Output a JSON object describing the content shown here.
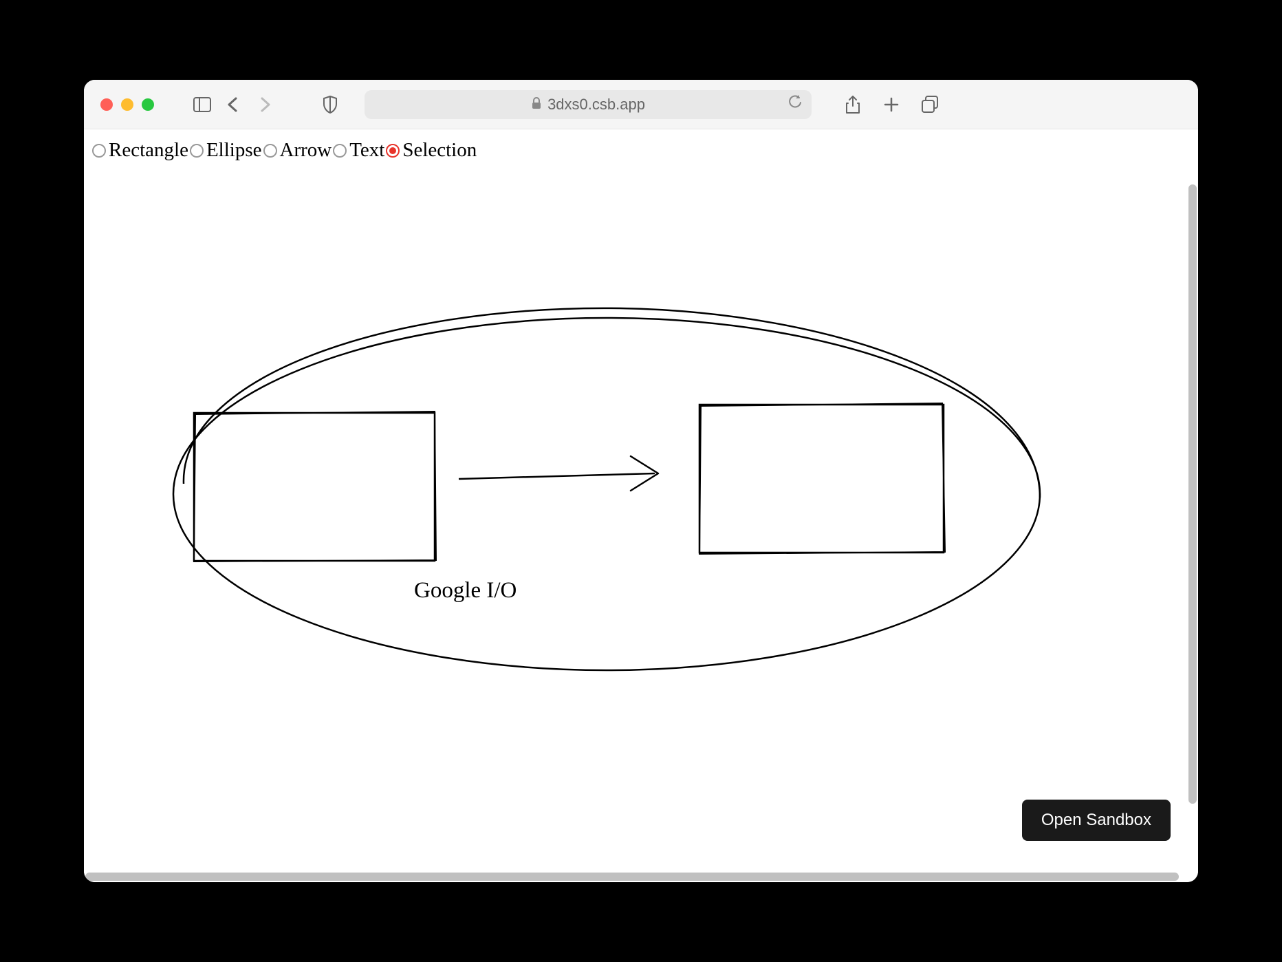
{
  "browser": {
    "url": "3dxs0.csb.app"
  },
  "tools": {
    "items": [
      {
        "label": "Rectangle",
        "selected": false
      },
      {
        "label": "Ellipse",
        "selected": false
      },
      {
        "label": "Arrow",
        "selected": false
      },
      {
        "label": "Text",
        "selected": false
      },
      {
        "label": "Selection",
        "selected": true
      }
    ]
  },
  "canvas": {
    "text_label": "Google I/O"
  },
  "sandbox": {
    "button_label": "Open Sandbox"
  }
}
